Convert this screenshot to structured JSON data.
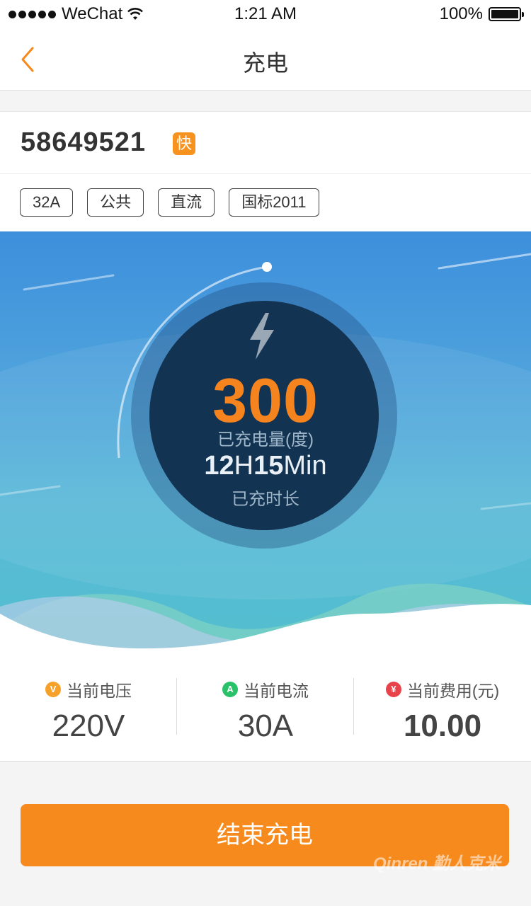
{
  "status_bar": {
    "carrier": "WeChat",
    "time": "1:21 AM",
    "battery": "100%"
  },
  "nav": {
    "title": "充电"
  },
  "station": {
    "id": "58649521",
    "speed_badge": "快",
    "tags": [
      "32A",
      "公共",
      "直流",
      "国标2011"
    ]
  },
  "charging": {
    "energy_value": "300",
    "energy_label": "已充电量(度)",
    "duration_hours": "12",
    "duration_h_unit": "H",
    "duration_minutes": "15",
    "duration_min_unit": "Min",
    "duration_label": "已充时长"
  },
  "stats": {
    "voltage": {
      "icon": "V",
      "label": "当前电压",
      "value": "220V",
      "icon_color": "#f7a12a"
    },
    "current": {
      "icon": "A",
      "label": "当前电流",
      "value": "30A",
      "icon_color": "#29c26a"
    },
    "cost": {
      "icon": "¥",
      "label": "当前费用(元)",
      "value": "10.00",
      "icon_color": "#e8424a"
    }
  },
  "action": {
    "end_label": "结束充电"
  },
  "watermark": {
    "text": "Qinren 勤人克米"
  },
  "colors": {
    "accent": "#f68a1c",
    "energy_value": "#f5841e",
    "gauge_center": "#133352"
  }
}
